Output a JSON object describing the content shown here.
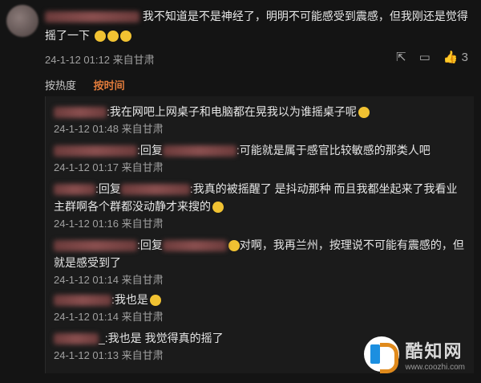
{
  "comment": {
    "text": "我不知道是不是神经了，明明不可能感受到震感，但我刚还是觉得摇了一下",
    "meta": "24-1-12 01:12 来自甘肃",
    "like_count": "3"
  },
  "sort": {
    "hot": "按热度",
    "time": "按时间"
  },
  "replies": [
    {
      "text": ":我在网吧上网桌子和电脑都在晃我以为谁摇桌子呢",
      "meta": "24-1-12 01:48 来自甘肃"
    },
    {
      "prefix": ":回复",
      "text": ":可能就是属于感官比较敏感的那类人吧",
      "meta": "24-1-12 01:17 来自甘肃"
    },
    {
      "prefix": ":回复",
      "text": ":我真的被摇醒了 是抖动那种 而且我都坐起来了我看业主群啊各个群都没动静才来搜的",
      "meta": "24-1-12 01:16 来自甘肃"
    },
    {
      "prefix": ":回复",
      "text": "对啊，我再兰州，按理说不可能有震感的，但就是感受到了",
      "meta": "24-1-12 01:14 来自甘肃"
    },
    {
      "text": ":我也是",
      "meta": "24-1-12 01:14 来自甘肃"
    },
    {
      "text": "_:我也是 我觉得真的摇了",
      "meta": "24-1-12 01:13 来自甘肃"
    }
  ],
  "watermark": {
    "name": "酷知网",
    "url": "www.coozhi.com"
  }
}
